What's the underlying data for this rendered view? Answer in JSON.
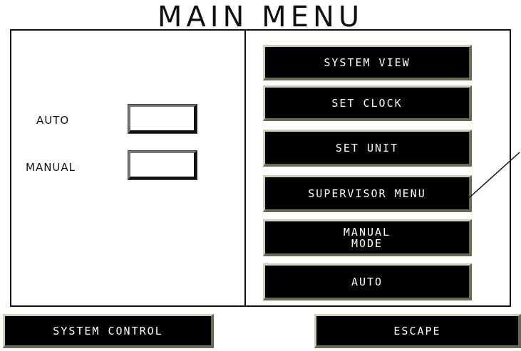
{
  "title": "MAIN MENU",
  "status": {
    "auto_label": "AUTO",
    "manual_label": "MANUAL"
  },
  "menu": {
    "system_view": "SYSTEM VIEW",
    "set_clock": "SET CLOCK",
    "set_unit": "SET UNIT",
    "supervisor_menu": "SUPERVISOR MENU",
    "manual_mode": "MANUAL\nMODE",
    "auto": "AUTO"
  },
  "footer": {
    "system_control": "SYSTEM CONTROL",
    "escape": "ESCAPE"
  },
  "colors": {
    "button_bg": "#000000",
    "button_text": "#ffffff",
    "button_bevel_light": "#cfcfb4",
    "button_bevel_dark": "#6a6a50"
  }
}
